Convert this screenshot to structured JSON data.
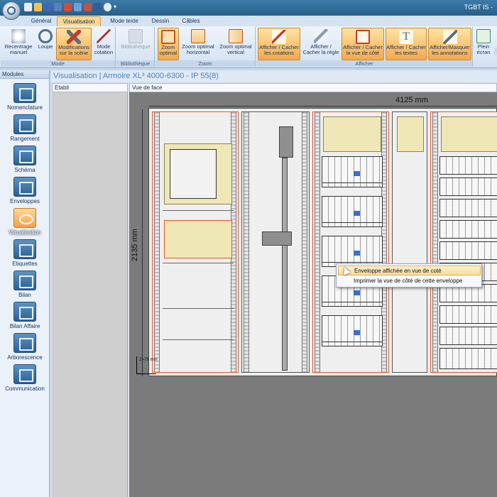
{
  "titlebar": {
    "title": "TGBT IS -"
  },
  "tabs": [
    {
      "label": "Général",
      "active": false
    },
    {
      "label": "Visualisation",
      "active": true
    },
    {
      "label": "Mode texte",
      "active": false
    },
    {
      "label": "Dessin",
      "active": false
    },
    {
      "label": "Câbles",
      "active": false
    }
  ],
  "ribbon": {
    "groups": {
      "mode": "Mode",
      "bibliotheque": "Bibliothèque",
      "zoom": "Zoom",
      "afficher": "Afficher"
    },
    "buttons": {
      "recentrage": "Recentrage manuel",
      "loupe": "Loupe",
      "modifications": "Modifications sur la scène",
      "mode_cotation": "Mode cotation",
      "bibliotheque": "Bibliothèque",
      "zoom_optimal": "Zoom optimal",
      "zoom_horizontal": "Zoom optimal horizontal",
      "zoom_vertical": "Zoom optimal vertical",
      "cotations": "Afficher / Cacher les cotations",
      "regle": "Afficher / Cacher la règle",
      "vue_cote": "Afficher / Cacher la vue de côté",
      "textes": "Afficher / Cacher les textes",
      "annotations": "Afficher/Masquer les annotations",
      "plein_ecran": "Plein écran"
    }
  },
  "modules": {
    "title": "Modules",
    "items": [
      {
        "label": "Nomenclature"
      },
      {
        "label": "Rangement"
      },
      {
        "label": "Schéma"
      },
      {
        "label": "Enveloppes"
      },
      {
        "label": "Visualisation"
      },
      {
        "label": "Etiquettes"
      },
      {
        "label": "Bilan"
      },
      {
        "label": "Bilan Affaire"
      },
      {
        "label": "Arborescence"
      },
      {
        "label": "Communication"
      }
    ]
  },
  "view": {
    "header": "Visualisation | Armoire XL³ 4000-6300 - IP 55(8)",
    "etabli_label": "Etabli",
    "vue_label": "Vue de face",
    "dim_width": "4125 mm",
    "dim_height": "2135 mm",
    "axis_label": "Z=78 mm"
  },
  "context_menu": {
    "items": [
      {
        "label": "Enveloppe affichée en vue de coté"
      },
      {
        "label": "Imprimer la vue de côté de cette enveloppe"
      }
    ]
  },
  "colors": {
    "accent": "#f6a84a",
    "selection": "#e2582a",
    "header_text": "#4f7fb6"
  }
}
